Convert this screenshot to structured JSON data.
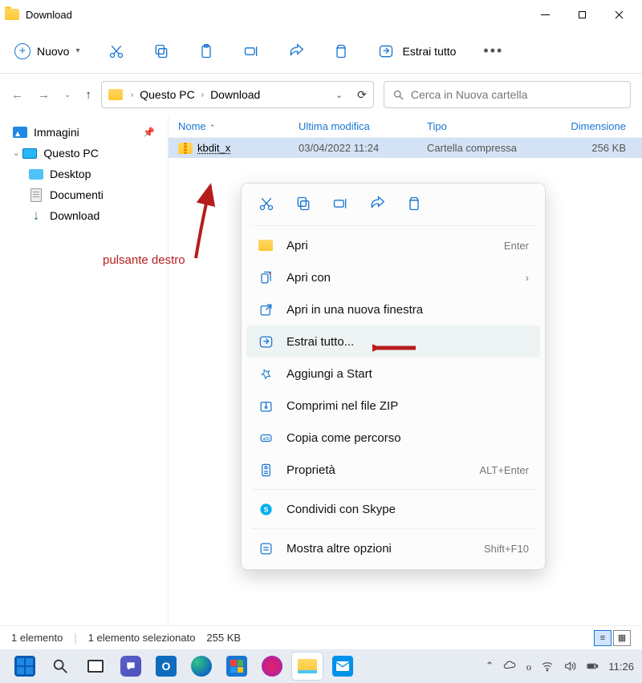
{
  "window": {
    "title": "Download"
  },
  "toolbar": {
    "new_label": "Nuovo",
    "extract_label": "Estrai tutto"
  },
  "breadcrumb": {
    "items": [
      "Questo PC",
      "Download"
    ]
  },
  "search": {
    "placeholder": "Cerca in Nuova cartella"
  },
  "sidebar": {
    "immagini": "Immagini",
    "questo_pc": "Questo PC",
    "desktop": "Desktop",
    "documenti": "Documenti",
    "download": "Download"
  },
  "columns": {
    "name": "Nome",
    "modified": "Ultima modifica",
    "type": "Tipo",
    "size": "Dimensione"
  },
  "file": {
    "name": "kbdit_x",
    "modified": "03/04/2022 11:24",
    "type": "Cartella compressa",
    "size": "256 KB"
  },
  "annotation": {
    "label": "pulsante destro"
  },
  "context_menu": {
    "open": "Apri",
    "open_shortcut": "Enter",
    "open_with": "Apri con",
    "open_new_window": "Apri in una nuova finestra",
    "extract_all": "Estrai tutto...",
    "pin_start": "Aggiungi a Start",
    "compress_zip": "Comprimi nel file ZIP",
    "copy_path": "Copia come percorso",
    "properties": "Proprietà",
    "properties_shortcut": "ALT+Enter",
    "share_skype": "Condividi con Skype",
    "more_options": "Mostra altre opzioni",
    "more_options_shortcut": "Shift+F10"
  },
  "statusbar": {
    "count": "1 elemento",
    "selected": "1 elemento selezionato",
    "sel_size": "255 KB"
  },
  "systray": {
    "time": "11:26"
  }
}
